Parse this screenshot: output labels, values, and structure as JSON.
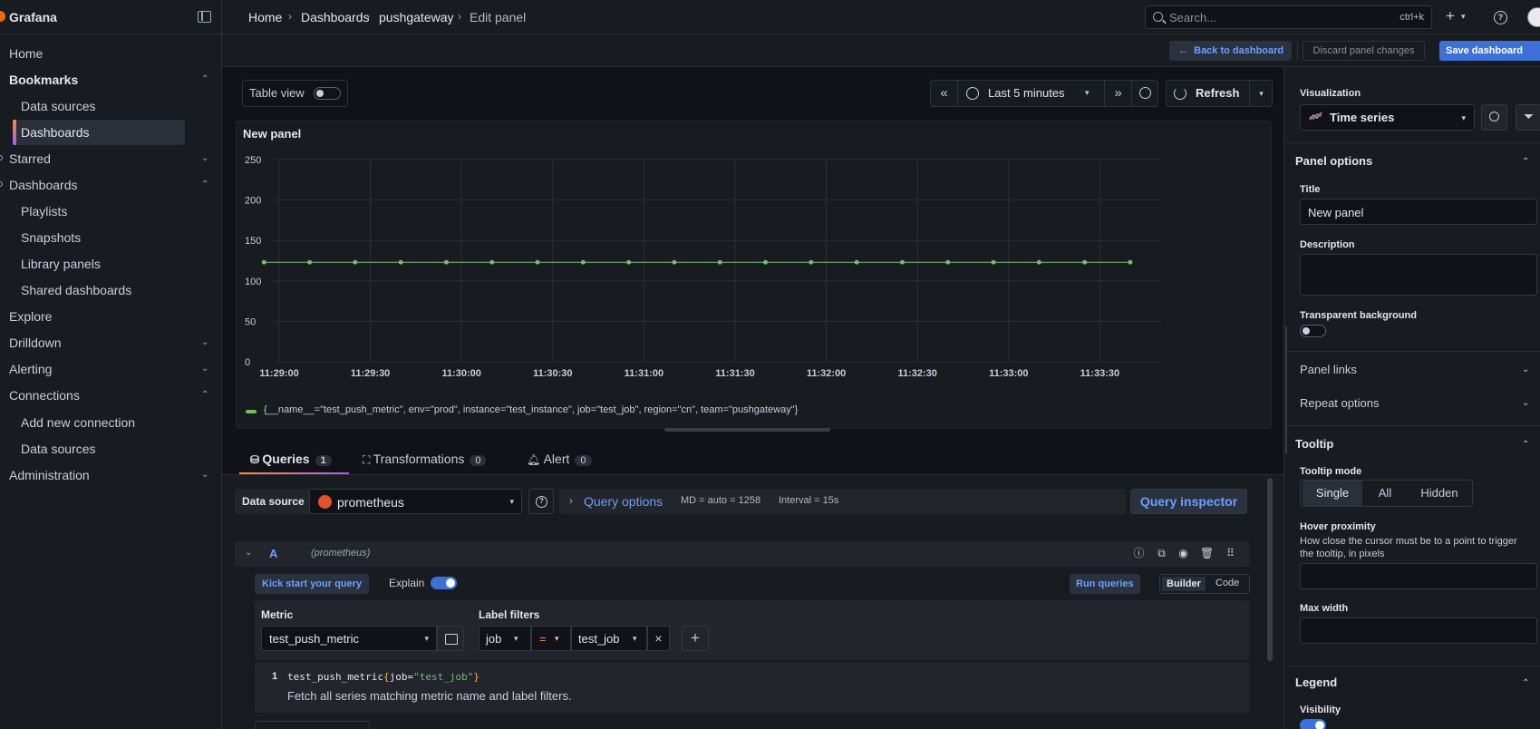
{
  "app": {
    "brand": "Grafana"
  },
  "sidebar": {
    "items": [
      {
        "label": "Home"
      },
      {
        "label": "Bookmarks"
      },
      {
        "label": "Data sources"
      },
      {
        "label": "Dashboards"
      },
      {
        "label": "Starred"
      },
      {
        "label": "Dashboards"
      },
      {
        "label": "Playlists"
      },
      {
        "label": "Snapshots"
      },
      {
        "label": "Library panels"
      },
      {
        "label": "Shared dashboards"
      },
      {
        "label": "Explore"
      },
      {
        "label": "Drilldown"
      },
      {
        "label": "Alerting"
      },
      {
        "label": "Connections"
      },
      {
        "label": "Add new connection"
      },
      {
        "label": "Data sources"
      },
      {
        "label": "Administration"
      }
    ]
  },
  "topbar": {
    "breadcrumbs": [
      "Home",
      "Dashboards",
      "pushgateway",
      "Edit panel"
    ],
    "search_placeholder": "Search...",
    "search_shortcut": "ctrl+k"
  },
  "toolbar": {
    "back": "Back to dashboard",
    "discard": "Discard panel changes",
    "save": "Save dashboard"
  },
  "panel_toolbar": {
    "table_view": "Table view",
    "time_range": "Last 5 minutes",
    "refresh": "Refresh"
  },
  "panel": {
    "title": "New panel",
    "legend": "{__name__=\"test_push_metric\", env=\"prod\", instance=\"test_instance\", job=\"test_job\", region=\"cn\", team=\"pushgateway\"}"
  },
  "chart_data": {
    "type": "line",
    "x": [
      "11:28:55",
      "11:29:10",
      "11:29:25",
      "11:29:40",
      "11:29:55",
      "11:30:10",
      "11:30:25",
      "11:30:40",
      "11:30:55",
      "11:31:10",
      "11:31:25",
      "11:31:40",
      "11:31:55",
      "11:32:10",
      "11:32:25",
      "11:32:40",
      "11:32:55",
      "11:33:10",
      "11:33:25",
      "11:33:40"
    ],
    "x_ticks": [
      "11:29:00",
      "11:29:30",
      "11:30:00",
      "11:30:30",
      "11:31:00",
      "11:31:30",
      "11:32:00",
      "11:32:30",
      "11:33:00",
      "11:33:30"
    ],
    "y_ticks": [
      "250",
      "200",
      "150",
      "100",
      "50",
      "0"
    ],
    "ylim": [
      0,
      250
    ],
    "series": [
      {
        "name": "{__name__=\"test_push_metric\", env=\"prod\", instance=\"test_instance\", job=\"test_job\", region=\"cn\", team=\"pushgateway\"}",
        "values": [
          123,
          123,
          123,
          123,
          123,
          123,
          123,
          123,
          123,
          123,
          123,
          123,
          123,
          123,
          123,
          123,
          123,
          123,
          123,
          123
        ],
        "color": "#73bf69"
      }
    ],
    "grid": true,
    "legend": "bottom"
  },
  "query_tabs": [
    {
      "label": "Queries",
      "count": "1"
    },
    {
      "label": "Transformations",
      "count": "0"
    },
    {
      "label": "Alert",
      "count": "0"
    }
  ],
  "query": {
    "ds_label": "Data source",
    "ds_value": "prometheus",
    "options_title": "Query options",
    "options_md": "MD = auto = 1258",
    "options_interval": "Interval = 15s",
    "inspector": "Query inspector",
    "row_id": "A",
    "row_ds": "(prometheus)",
    "kick": "Kick start your query",
    "explain": "Explain",
    "run": "Run queries",
    "builder": "Builder",
    "code": "Code",
    "metric_label": "Metric",
    "metric_value": "test_push_metric",
    "label_filters_label": "Label filters",
    "lf_key": "job",
    "lf_op": "=",
    "lf_value": "test_job",
    "code_num": "1",
    "code_metric": "test_push_metric",
    "code_key": "job=",
    "code_val": "\"test_job\"",
    "code_desc": "Fetch all series matching metric name and label filters."
  },
  "options": {
    "viz_label": "Visualization",
    "viz_value": "Time series",
    "panel_options": "Panel options",
    "title_label": "Title",
    "title_value": "New panel",
    "description_label": "Description",
    "transparent_label": "Transparent background",
    "panel_links": "Panel links",
    "repeat_options": "Repeat options",
    "tooltip": "Tooltip",
    "tooltip_mode": "Tooltip mode",
    "tt_single": "Single",
    "tt_all": "All",
    "tt_hidden": "Hidden",
    "hover_label": "Hover proximity",
    "hover_desc": "How close the cursor must be to a point to trigger the tooltip, in pixels",
    "max_width": "Max width",
    "legend": "Legend",
    "visibility": "Visibility"
  },
  "colors": {
    "accent": "#3d71d9",
    "link": "#6e9fff",
    "series": "#73bf69"
  }
}
